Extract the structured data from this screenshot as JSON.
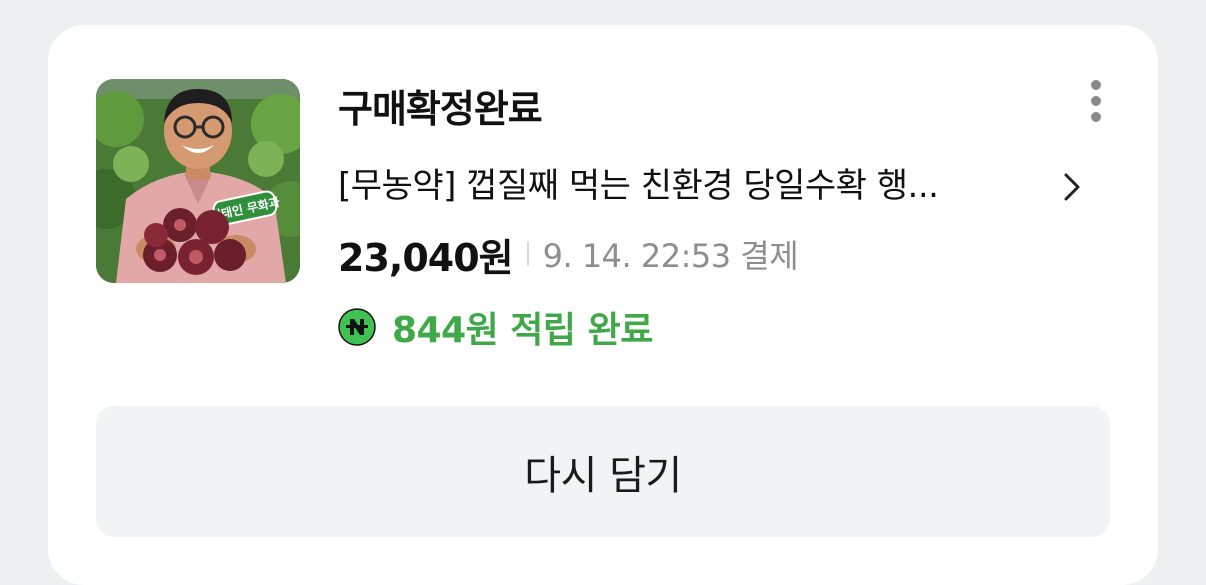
{
  "order": {
    "status": "구매확정완료",
    "product_title": "[무농약] 껍질째 먹는 친환경 당일수확 행...",
    "price": "23,040원",
    "payment_info": "9. 14. 22:53 결제",
    "points": {
      "text": "844원 적립 완료",
      "color": "#3fa94a"
    },
    "thumbnail_badge": "서태인 무화과"
  },
  "actions": {
    "recart_label": "다시 담기"
  },
  "icons": {
    "more": "more-vertical-icon",
    "chevron": "chevron-right-icon",
    "points": "naver-pay-icon"
  }
}
